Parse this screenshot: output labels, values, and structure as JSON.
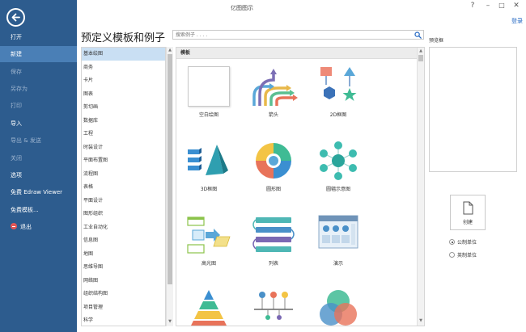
{
  "window": {
    "title": "亿图图示",
    "login_link": "登录"
  },
  "sidebar": {
    "items": [
      {
        "label": "打开",
        "state": "normal"
      },
      {
        "label": "新建",
        "state": "active"
      },
      {
        "label": "保存",
        "state": "disabled"
      },
      {
        "label": "另存为",
        "state": "disabled"
      },
      {
        "label": "打印",
        "state": "disabled"
      },
      {
        "label": "导入",
        "state": "normal"
      },
      {
        "label": "导出 & 发送",
        "state": "disabled"
      },
      {
        "label": "关闭",
        "state": "disabled"
      },
      {
        "label": "选项",
        "state": "normal"
      },
      {
        "label": "免费 Edraw Viewer",
        "state": "normal"
      },
      {
        "label": "免费模板...",
        "state": "normal"
      },
      {
        "label": "退出",
        "state": "normal"
      }
    ]
  },
  "main": {
    "page_title": "预定义模板和例子",
    "search": {
      "placeholder": "搜索例子 . . . .",
      "value": ""
    },
    "categories": [
      "基本绘图",
      "商务",
      "卡片",
      "图表",
      "剪切画",
      "数据库",
      "工程",
      "时装设计",
      "平面布置图",
      "流程图",
      "表格",
      "平面设计",
      "图形组织",
      "工业自动化",
      "信息图",
      "地图",
      "思维导图",
      "网络图",
      "组织结构图",
      "项目管理",
      "科学"
    ],
    "selected_category": "基本绘图",
    "template_section_label": "模板",
    "templates": [
      "空白绘图",
      "箭头",
      "2D框图",
      "3D框图",
      "圆形图",
      "圆辐示意图",
      "高光图",
      "列表",
      "演示",
      "",
      "",
      ""
    ]
  },
  "right_panel": {
    "preview_label": "预览框",
    "create_label": "创建",
    "units": [
      {
        "label": "公制单位",
        "checked": true
      },
      {
        "label": "英制单位",
        "checked": false
      }
    ]
  },
  "colors": {
    "sidebar_bg": "#2d5c8e",
    "sidebar_active": "#4a7fb6",
    "selected_category_bg": "#c9dff3",
    "accent_blue": "#2166c2"
  }
}
